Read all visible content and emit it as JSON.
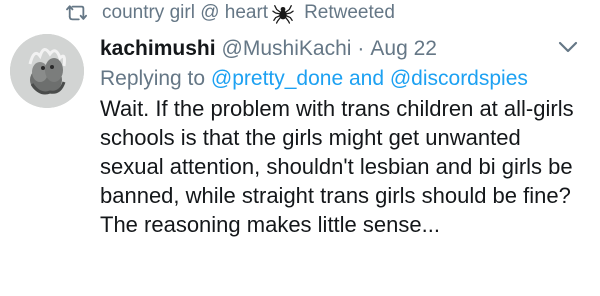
{
  "retweet": {
    "retweeter_name_prefix": "country girl @ heart",
    "retweeter_icon": "spider-icon",
    "label": "Retweeted"
  },
  "tweet": {
    "display_name": "kachimushi",
    "handle": "@MushiKachi",
    "separator": "·",
    "date": "Aug 22",
    "replying_prefix": "Replying to",
    "replying_mentions": "@pretty_done and @discordspies",
    "text": "Wait. If the problem with trans children at all-girls schools is that the girls might get unwanted sexual attention, shouldn't lesbian and bi girls be banned, while straight trans girls should be fine? The reasoning makes little sense..."
  },
  "colors": {
    "muted": "#657786",
    "link": "#1da1f2",
    "text": "#14171a"
  },
  "icons": {
    "retweet": "retweet-icon",
    "menu": "chevron-down-icon"
  }
}
